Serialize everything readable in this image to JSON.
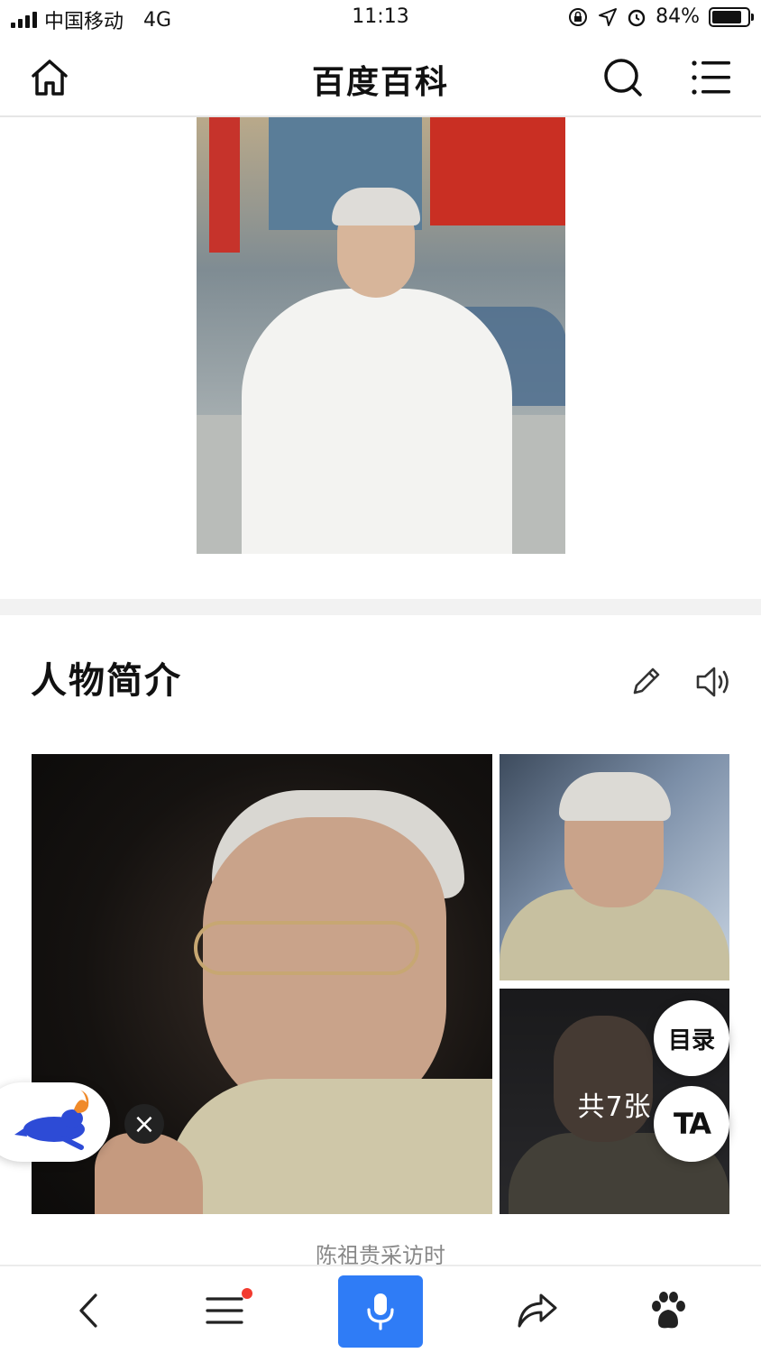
{
  "status_bar": {
    "carrier": "中国移动",
    "network": "4G",
    "time": "11:13",
    "battery": "84%",
    "battery_level": 0.84
  },
  "nav": {
    "title": "百度百科",
    "home_icon": "home-icon",
    "search_icon": "search-icon",
    "menu_icon": "menu-icon"
  },
  "section": {
    "title": "人物简介",
    "edit_icon": "pencil-icon",
    "audio_icon": "speaker-icon"
  },
  "gallery": {
    "count_label": "共7张",
    "caption": "陈祖贵采访时"
  },
  "floating": {
    "toc_label": "目录",
    "ta_label": "TA"
  },
  "toolbar": {
    "back_icon": "back-arrow-icon",
    "list_icon": "list-icon",
    "voice_icon": "microphone-icon",
    "share_icon": "share-icon",
    "paw_icon": "baidu-paw-icon"
  },
  "colors": {
    "accent": "#2f7cf6",
    "notification_dot": "#f23b2f"
  }
}
